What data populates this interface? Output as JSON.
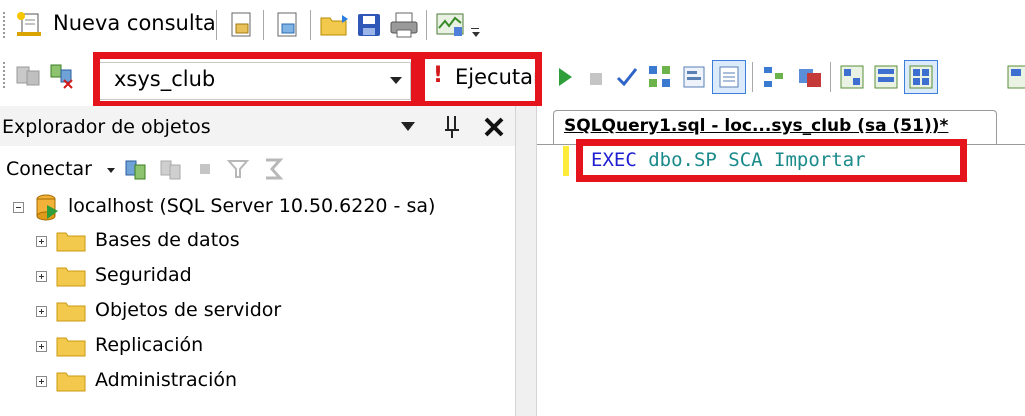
{
  "toolbar": {
    "new_query_label": "Nueva consulta",
    "database_value": "xsys_club",
    "execute_label": "Ejecutar"
  },
  "object_explorer": {
    "title": "Explorador de objetos",
    "connect_label": "Conectar",
    "server_node": "localhost (SQL Server 10.50.6220 - sa)",
    "folders": [
      "Bases de datos",
      "Seguridad",
      "Objetos de servidor",
      "Replicación",
      "Administración"
    ]
  },
  "editor": {
    "tab_title": "SQLQuery1.sql - loc...sys_club (sa (51))*",
    "code_keyword": "EXEC",
    "code_identifier": "dbo.SP SCA Importar"
  },
  "colors": {
    "highlight_red": "#e5141c",
    "keyword_blue": "#1f1fd1",
    "identifier_teal": "#1a8a8a",
    "change_marker_yellow": "#ffec3a"
  },
  "icons": [
    "new-query-icon",
    "file-icon",
    "file-icon",
    "open-folder-icon",
    "save-icon",
    "print-icon",
    "activity-monitor-icon",
    "overflow-icon",
    "connect-db-icon",
    "change-connection-icon",
    "execute-icon",
    "debug-play-icon",
    "stop-icon",
    "check-icon",
    "parse-icon",
    "estimated-plan-icon",
    "results-icon",
    "pin-icon",
    "close-icon",
    "filter-icon",
    "refresh-icon",
    "folder-icon",
    "server-icon"
  ]
}
